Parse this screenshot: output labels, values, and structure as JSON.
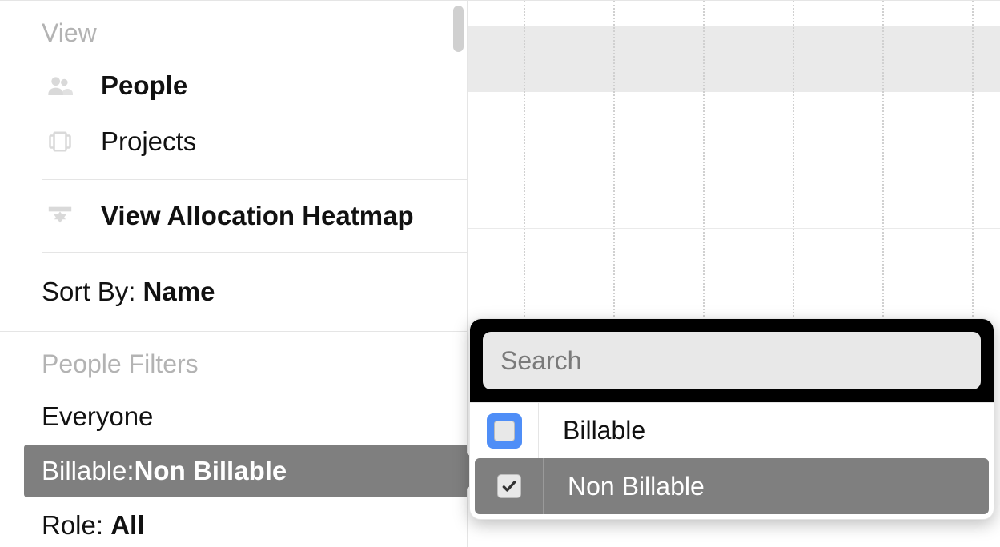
{
  "sidebar": {
    "view_header": "View",
    "people_label": "People",
    "projects_label": "Projects",
    "heatmap_label": "View Allocation Heatmap",
    "sort_label": "Sort By: ",
    "sort_value": "Name",
    "filters_header": "People Filters",
    "filter_everyone": "Everyone",
    "filter_billable_label": "Billable: ",
    "filter_billable_value": "Non Billable",
    "filter_role_label": "Role: ",
    "filter_role_value": "All"
  },
  "popover": {
    "search_placeholder": "Search",
    "option_billable": "Billable",
    "option_non_billable": "Non Billable"
  }
}
